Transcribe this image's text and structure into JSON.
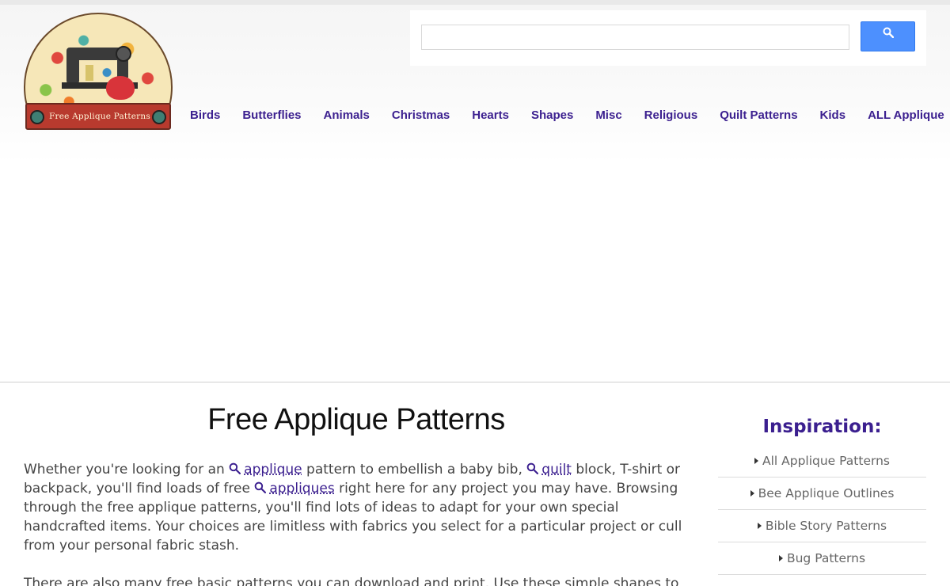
{
  "logo": {
    "banner_text": "Free Applique Patterns"
  },
  "search": {
    "value": "",
    "placeholder": "",
    "button_icon": "search-icon"
  },
  "nav": {
    "items": [
      {
        "label": "Birds"
      },
      {
        "label": "Butterflies"
      },
      {
        "label": "Animals"
      },
      {
        "label": "Christmas"
      },
      {
        "label": "Hearts"
      },
      {
        "label": "Shapes"
      },
      {
        "label": "Misc"
      },
      {
        "label": "Religious"
      },
      {
        "label": "Quilt Patterns"
      },
      {
        "label": "Kids"
      },
      {
        "label": "ALL Applique"
      }
    ]
  },
  "main": {
    "title": "Free Applique Patterns",
    "p1": {
      "t1": "Whether you're looking for an ",
      "k1": "applique",
      "t2": " pattern to embellish a baby bib, ",
      "k2": "quilt",
      "t3": " block, T-shirt or backpack, you'll find loads of free ",
      "k3": "appliques",
      "t4": " right here for any project you may have. Browsing through the free applique patterns, you'll find lots of ideas to adapt for your own special handcrafted items. Your choices are limitless with fabrics you select for a particular project or cull from your personal fabric stash."
    },
    "p2": "There are also many free basic patterns you can download and print. Use these simple shapes to"
  },
  "sidebar": {
    "title": "Inspiration:",
    "items": [
      {
        "label": "All Applique Patterns"
      },
      {
        "label": "Bee Applique Outlines"
      },
      {
        "label": "Bible Story Patterns"
      },
      {
        "label": "Bug Patterns"
      }
    ]
  },
  "colors": {
    "link": "#3b1f8f",
    "search_button": "#4d90fe",
    "banner": "#b83a2e"
  }
}
